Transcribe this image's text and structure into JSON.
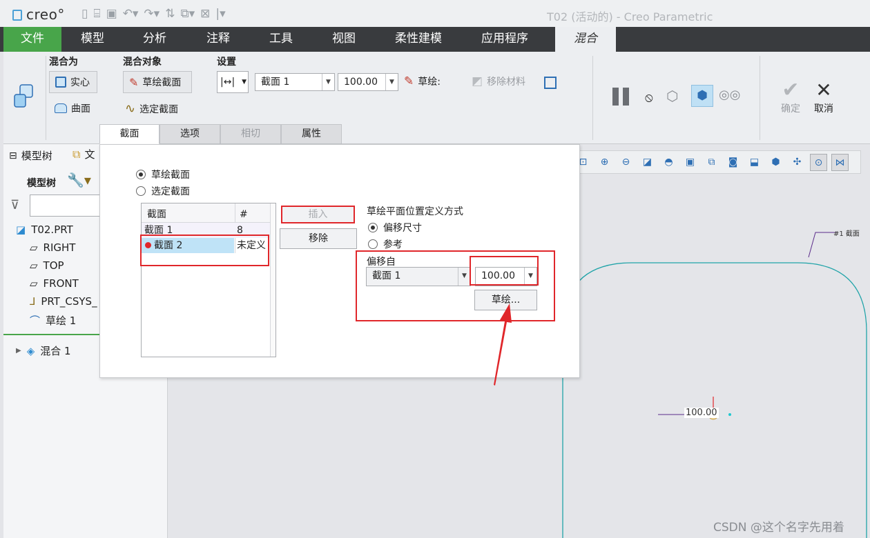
{
  "app": {
    "logo_text": "creo°",
    "window_title": "T02 (活动的) - Creo Parametric",
    "quick_access": [
      "new-icon",
      "open-icon",
      "save-icon",
      "undo-icon",
      "redo-icon",
      "regenerate-icon",
      "windows-icon",
      "close-window-icon",
      "customize-icon"
    ]
  },
  "ribbon_tabs": [
    "文件",
    "模型",
    "分析",
    "注释",
    "工具",
    "视图",
    "柔性建模",
    "应用程序",
    "混合"
  ],
  "ribbon": {
    "blend_as_label": "混合为",
    "solid_label": "实心",
    "surface_label": "曲面",
    "blend_object_label": "混合对象",
    "sketch_section_label": "草绘截面",
    "select_section_label": "选定截面",
    "settings_label": "设置",
    "section_select": "截面 1",
    "offset_value": "100.00",
    "sketch_label": "草绘:",
    "remove_material_label": "移除材料",
    "confirm_label": "确定",
    "cancel_label": "取消"
  },
  "sub_tabs": [
    "截面",
    "选项",
    "相切",
    "属性"
  ],
  "model_tree": {
    "tab_label": "模型树",
    "second_tab_label": "文",
    "header_label": "模型树",
    "items": [
      {
        "label": "T02.PRT",
        "icon": "part-icon"
      },
      {
        "label": "RIGHT",
        "icon": "datum-plane-icon"
      },
      {
        "label": "TOP",
        "icon": "datum-plane-icon"
      },
      {
        "label": "FRONT",
        "icon": "datum-plane-icon"
      },
      {
        "label": "PRT_CSYS_",
        "icon": "csys-icon"
      },
      {
        "label": "草绘 1",
        "icon": "sketch-icon"
      },
      {
        "label": "混合 1",
        "icon": "blend-icon"
      }
    ]
  },
  "dialog": {
    "radio_sketch": "草绘截面",
    "radio_select": "选定截面",
    "table_headers": [
      "截面",
      "#"
    ],
    "table_rows": [
      {
        "section": "截面 1",
        "count": "8"
      },
      {
        "section": "截面 2",
        "count": "未定义"
      }
    ],
    "insert_label": "插入",
    "remove_label": "移除",
    "plane_def_title": "草绘平面位置定义方式",
    "radio_offset_dim": "偏移尺寸",
    "radio_reference": "参考",
    "offset_from_label": "偏移自",
    "offset_from_select": "截面 1",
    "offset_value": "100.00",
    "sketch_button": "草绘..."
  },
  "canvas": {
    "dimension_text": "100.00",
    "section_annotation": "#1 截面"
  },
  "watermark": "CSDN @这个名字先用着",
  "colors": {
    "file_tab": "#48a54a",
    "tab_bar": "#393b3e",
    "highlight_box": "#e0262a",
    "sketch_curve": "#1fa3a8",
    "selected_row": "#bfe3f7"
  }
}
